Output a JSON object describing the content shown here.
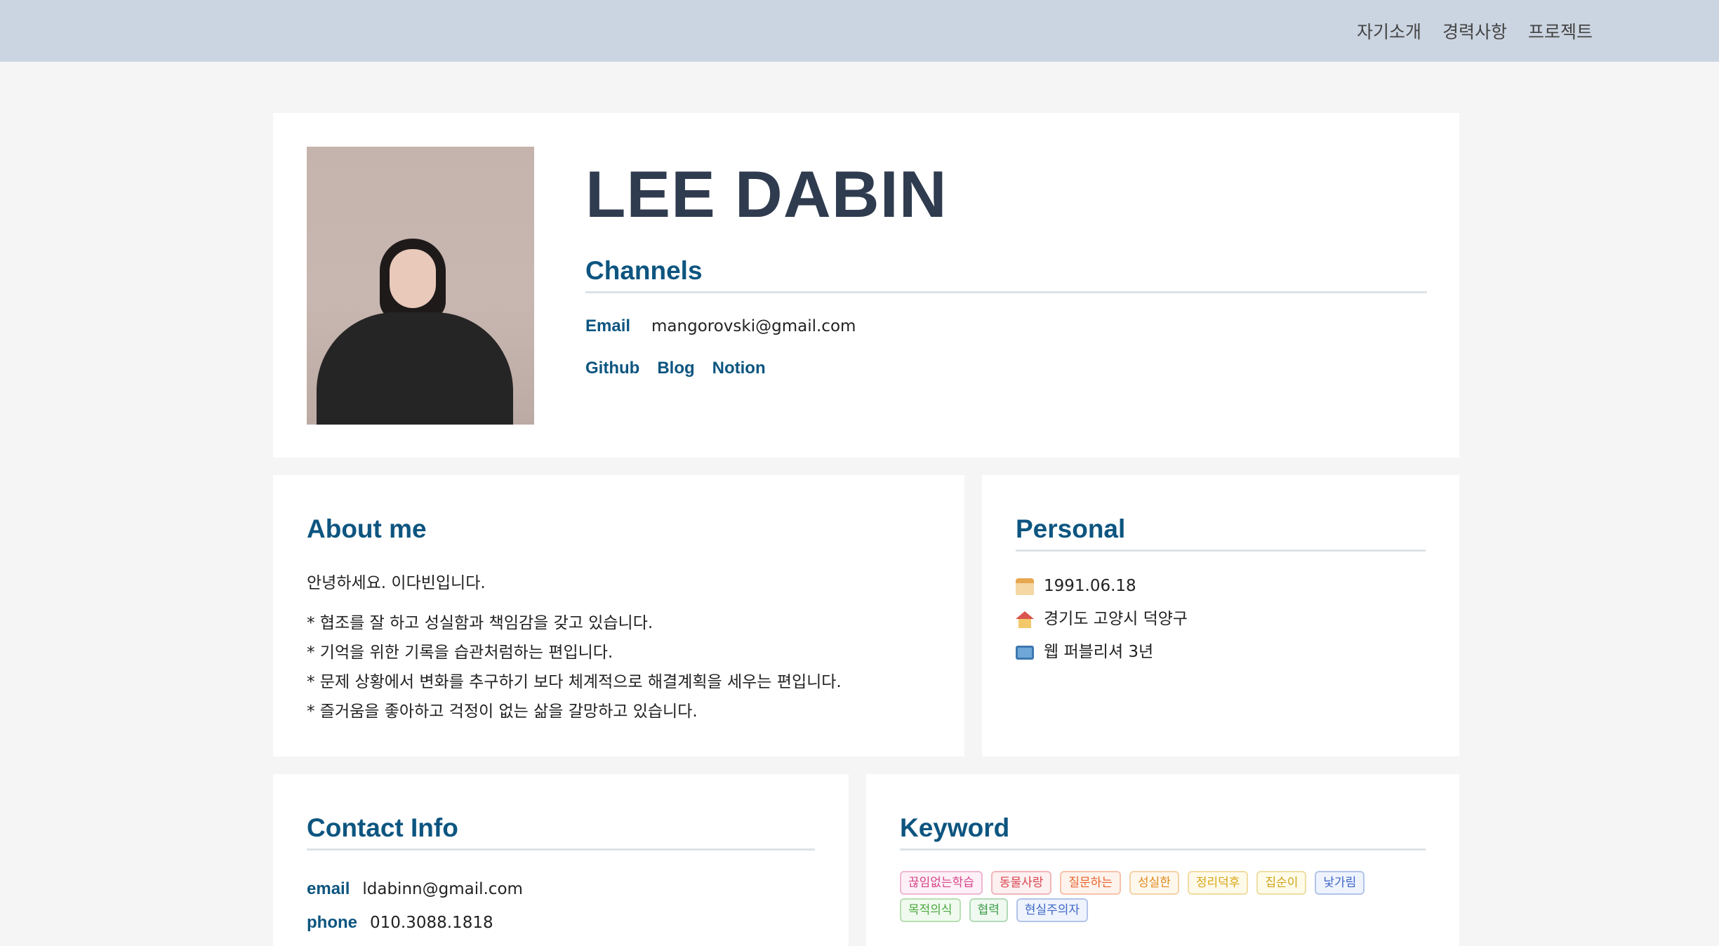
{
  "nav": {
    "items": [
      "자기소개",
      "경력사항",
      "프로젝트"
    ]
  },
  "profile": {
    "name": "LEE DABIN",
    "channels_title": "Channels",
    "email_label": "Email",
    "email_value": "mangorovski@gmail.com",
    "links": [
      "Github",
      "Blog",
      "Notion"
    ]
  },
  "about": {
    "title": "About me",
    "greeting": "안녕하세요. 이다빈입니다.",
    "items": [
      "* 협조를 잘 하고 성실함과 책임감을 갖고 있습니다.",
      "* 기억을 위한 기록을 습관처럼하는 편입니다.",
      "* 문제 상황에서 변화를 추구하기 보다 체계적으로 해결계획을 세우는 편입니다.",
      "* 즐거움을 좋아하고 걱정이 없는 삶을 갈망하고 있습니다."
    ]
  },
  "personal": {
    "title": "Personal",
    "items": [
      {
        "icon": "cake-icon",
        "text": "1991.06.18"
      },
      {
        "icon": "house-icon",
        "text": "경기도 고양시 덕양구"
      },
      {
        "icon": "laptop-icon",
        "text": "웹 퍼블리셔 3년"
      }
    ]
  },
  "contact": {
    "title": "Contact Info",
    "email_label": "email",
    "email_value": "ldabinn@gmail.com",
    "phone_label": "phone",
    "phone_value": "010.3088.1818"
  },
  "keyword": {
    "title": "Keyword",
    "tags": [
      {
        "text": "끊임없는학습",
        "color": "#d6458b",
        "bg": "#fdf0f6"
      },
      {
        "text": "동물사랑",
        "color": "#d9434f",
        "bg": "#fdf0f0"
      },
      {
        "text": "질문하는",
        "color": "#e8622a",
        "bg": "#fef3ec"
      },
      {
        "text": "성실한",
        "color": "#e0891e",
        "bg": "#fef7ec"
      },
      {
        "text": "정리덕후",
        "color": "#d9a516",
        "bg": "#fefaea"
      },
      {
        "text": "집순이",
        "color": "#cfa419",
        "bg": "#fefbe9"
      },
      {
        "text": "낯가림",
        "color": "#3f66c7",
        "bg": "#eef3fd"
      },
      {
        "text": "목적의식",
        "color": "#4aa83d",
        "bg": "#f0faef"
      },
      {
        "text": "협력",
        "color": "#3b9b47",
        "bg": "#eff9f0"
      },
      {
        "text": "현실주의자",
        "color": "#3f66c7",
        "bg": "#eef3fd"
      }
    ]
  }
}
